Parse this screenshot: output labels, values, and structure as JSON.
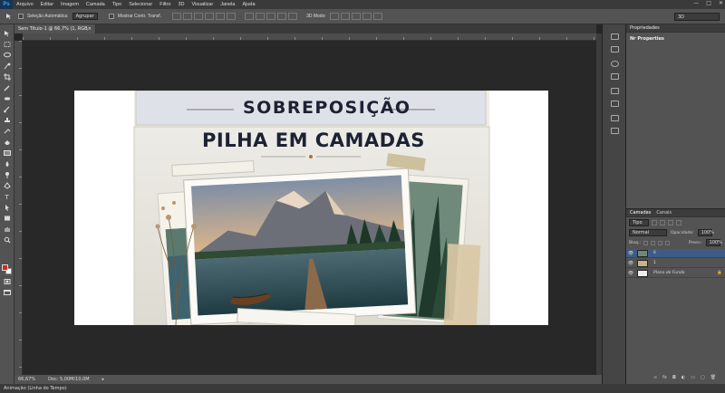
{
  "app": {
    "logo": "Ps"
  },
  "menu": [
    "Arquivo",
    "Editar",
    "Imagem",
    "Camada",
    "Tipo",
    "Selecionar",
    "Filtro",
    "3D",
    "Visualizar",
    "Janela",
    "Ajuda"
  ],
  "window_controls": {
    "minimize": "—",
    "maximize": "□",
    "close": "✕"
  },
  "options": {
    "auto_select_label": "Seleção Automática:",
    "auto_select_value": "Agrupar",
    "show_transform_label": "Mostrar Contr. Transf.",
    "mode_3d": "3D Modo:",
    "workspace": "3D"
  },
  "document": {
    "tab_title": "Sem Título-1 @ 66,7% (1, RGB/8) *",
    "tab_close": "×",
    "title_top": "SOBREPOSIÇÃO",
    "title_main": "PILHA EM CAMADAS"
  },
  "status": {
    "zoom": "66,67%",
    "doc": "Doc: 5,00M/10,0M"
  },
  "bottom_panel": {
    "label": "Animação (Linha do Tempo)"
  },
  "properties": {
    "tab": "Propriedades",
    "message": "Nr Properties"
  },
  "layers_panel": {
    "tabs": [
      "Camadas",
      "Canais"
    ],
    "kind": "Tipo",
    "blend_mode": "Normal",
    "opacity_label": "Opacidade:",
    "opacity_value": "100%",
    "lock_label": "Bloq.:",
    "fill_label": "Preen.:",
    "fill_value": "100%",
    "layers": [
      {
        "name": "6",
        "visible": true,
        "selected": true
      },
      {
        "name": "1",
        "visible": true,
        "selected": false
      },
      {
        "name": "Plano de Fundo",
        "visible": true,
        "selected": false
      }
    ]
  },
  "colors": {
    "accent": "#31a8ff",
    "foreground": "#d8291c",
    "background": "#ffffff",
    "selected_layer": "#3e5b86"
  }
}
